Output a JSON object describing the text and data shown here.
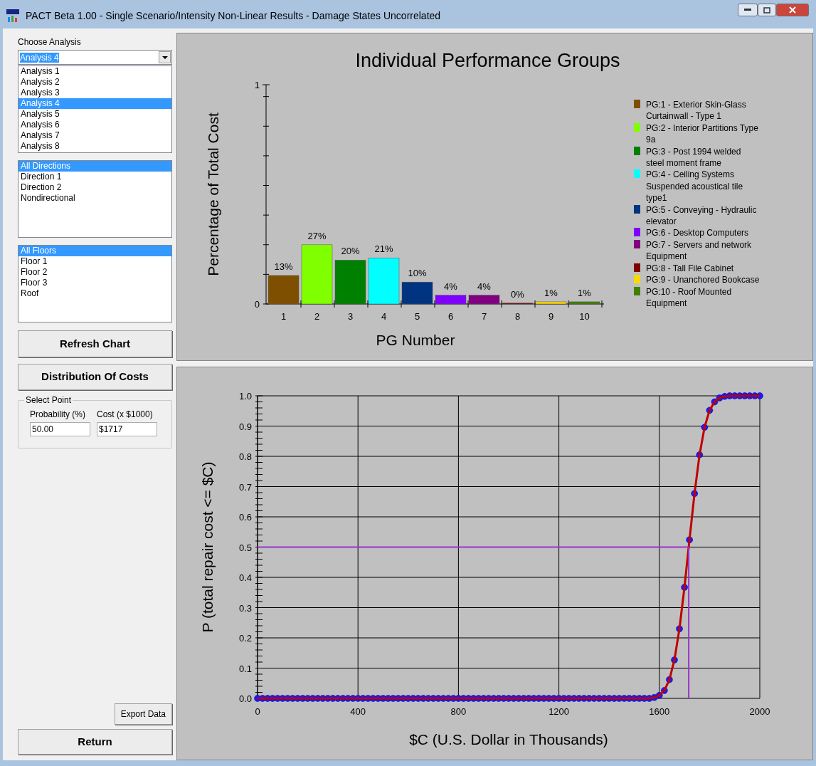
{
  "window": {
    "title": "PACT Beta 1.00 - Single Scenario/Intensity Non-Linear Results - Damage States Uncorrelated"
  },
  "left_panel": {
    "analysis_label": "Choose Analysis",
    "analysis_combo": {
      "value": "Analysis 4"
    },
    "analyses": [
      {
        "label": "Analysis 1",
        "selected": false
      },
      {
        "label": "Analysis 2",
        "selected": false
      },
      {
        "label": "Analysis 3",
        "selected": false
      },
      {
        "label": "Analysis 4",
        "selected": true
      },
      {
        "label": "Analysis 5",
        "selected": false
      },
      {
        "label": "Analysis 6",
        "selected": false
      },
      {
        "label": "Analysis 7",
        "selected": false
      },
      {
        "label": "Analysis 8",
        "selected": false
      }
    ],
    "directions": [
      {
        "label": "All Directions",
        "selected": true
      },
      {
        "label": "Direction 1",
        "selected": false
      },
      {
        "label": "Direction 2",
        "selected": false
      },
      {
        "label": "Nondirectional",
        "selected": false
      }
    ],
    "floors": [
      {
        "label": "All Floors",
        "selected": true
      },
      {
        "label": "Floor 1",
        "selected": false
      },
      {
        "label": "Floor 2",
        "selected": false
      },
      {
        "label": "Floor 3",
        "selected": false
      },
      {
        "label": "Roof",
        "selected": false
      }
    ],
    "refresh_button": "Refresh Chart",
    "distribution_button": "Distribution Of Costs",
    "select_point": {
      "title": "Select Point",
      "fields": [
        {
          "label": "Probability (%)",
          "value": "50.00"
        },
        {
          "label": "Cost (x $1000)",
          "value": "$1717"
        }
      ]
    },
    "export_button": "Export Data",
    "return_button": "Return"
  },
  "performance_chart": {
    "chart_data": {
      "type": "bar",
      "title": "Individual Performance Groups",
      "xlabel": "PG Number",
      "ylabel": "Percentage of Total Cost",
      "categories": [
        "1",
        "2",
        "3",
        "4",
        "5",
        "6",
        "7",
        "8",
        "9",
        "10"
      ],
      "values": [
        0.13,
        0.27,
        0.2,
        0.21,
        0.1,
        0.04,
        0.04,
        0.004,
        0.01,
        0.01
      ],
      "value_labels": [
        "13%",
        "27%",
        "20%",
        "21%",
        "10%",
        "4%",
        "4%",
        "0%",
        "1%",
        "1%"
      ],
      "ylim": [
        0,
        1
      ],
      "yticks": [
        0,
        1
      ]
    },
    "legend": [
      {
        "label": "PG:1 - Exterior Skin-Glass Curtainwall - Type 1",
        "color": "#7f4f00"
      },
      {
        "label": "PG:2 - Interior Partitions Type 9a",
        "color": "#80ff00"
      },
      {
        "label": "PG:3 - Post 1994 welded steel moment frame",
        "color": "#008000"
      },
      {
        "label": "PG:4 - Ceiling Systems Suspended acoustical tile type1",
        "color": "#00ffff"
      },
      {
        "label": "PG:5 - Conveying - Hydraulic elevator",
        "color": "#003380"
      },
      {
        "label": "PG:6 - Desktop Computers",
        "color": "#8000ff"
      },
      {
        "label": "PG:7 - Servers and network Equipment",
        "color": "#800080"
      },
      {
        "label": "PG:8 - Tall File Cabinet",
        "color": "#800000"
      },
      {
        "label": "PG:9 - Unanchored Bookcase",
        "color": "#ffd700"
      },
      {
        "label": "PG:10 - Roof Mounted Equipment",
        "color": "#408000"
      }
    ]
  },
  "distribution_chart": {
    "chart_data": {
      "type": "line",
      "xlabel": "$C (U.S. Dollar in Thousands)",
      "ylabel": "P (total repair cost <= $C)",
      "x": [
        0,
        20,
        40,
        60,
        80,
        100,
        120,
        140,
        160,
        180,
        200,
        220,
        240,
        260,
        280,
        300,
        320,
        340,
        360,
        380,
        400,
        420,
        440,
        460,
        480,
        500,
        520,
        540,
        560,
        580,
        600,
        620,
        640,
        660,
        680,
        700,
        720,
        740,
        760,
        780,
        800,
        820,
        840,
        860,
        880,
        900,
        920,
        940,
        960,
        980,
        1000,
        1020,
        1040,
        1060,
        1080,
        1100,
        1120,
        1140,
        1160,
        1180,
        1200,
        1220,
        1240,
        1260,
        1280,
        1300,
        1320,
        1340,
        1360,
        1380,
        1400,
        1420,
        1440,
        1460,
        1480,
        1500,
        1520,
        1540,
        1560,
        1580,
        1600,
        1620,
        1640,
        1660,
        1680,
        1700,
        1720,
        1740,
        1760,
        1780,
        1800,
        1820,
        1840,
        1860,
        1880,
        1900,
        1920,
        1940,
        1960,
        1980,
        2000
      ],
      "grid": true,
      "series": [
        {
          "color": "#c00000",
          "marker": "circle",
          "values": [
            0,
            0,
            0,
            0,
            0,
            0,
            0,
            0,
            0,
            0,
            0,
            0,
            0,
            0,
            0,
            0,
            0,
            0,
            0,
            0,
            0,
            0,
            0,
            0,
            0,
            0,
            0,
            0,
            0,
            0,
            0,
            0,
            0,
            0,
            0,
            0,
            0,
            0,
            0,
            0,
            0,
            0,
            0,
            0,
            0,
            0,
            0,
            0,
            0,
            0,
            0,
            0,
            0,
            0,
            0,
            0,
            0,
            0,
            0,
            0,
            0,
            0,
            0,
            0,
            0,
            0,
            0,
            0,
            0,
            0,
            0,
            0,
            0,
            0,
            0,
            0,
            0,
            0,
            0,
            0.003,
            0.01,
            0.026,
            0.062,
            0.127,
            0.23,
            0.367,
            0.524,
            0.677,
            0.805,
            0.896,
            0.952,
            0.98,
            0.993,
            0.998,
            1,
            1,
            1,
            1,
            1,
            1,
            1
          ]
        }
      ],
      "xlim": [
        0,
        2000
      ],
      "ylim": [
        0,
        1
      ],
      "xticks": [
        0,
        400,
        800,
        1200,
        1600,
        2000
      ],
      "yticks": [
        {
          "value": 0,
          "label": "0.0"
        },
        {
          "value": 0.1,
          "label": "0.1"
        },
        {
          "value": 0.2,
          "label": "0.2"
        },
        {
          "value": 0.3,
          "label": "0.3"
        },
        {
          "value": 0.4,
          "label": "0.4"
        },
        {
          "value": 0.5,
          "label": "0.5"
        },
        {
          "value": 0.6,
          "label": "0.6"
        },
        {
          "value": 0.7,
          "label": "0.7"
        },
        {
          "value": 0.8,
          "label": "0.8"
        },
        {
          "value": 0.9,
          "label": "0.9"
        },
        {
          "value": 1,
          "label": "1.0"
        }
      ],
      "ref_lines": [
        {
          "axis": "y",
          "value": 0.5
        },
        {
          "axis": "x",
          "value": 1717
        }
      ]
    }
  }
}
